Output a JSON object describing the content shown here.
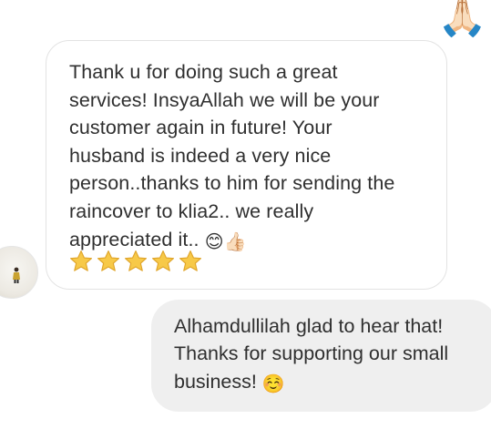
{
  "conversation": {
    "reaction_emoji": "🙏🏻",
    "incoming": {
      "lines": [
        "Thank u for doing such a great",
        "services! InsyaAllah we will be your",
        "customer again in future! Your",
        "husband is indeed a very nice",
        "person..thanks to him for sending the",
        "raincover to klia2.. we really",
        "appreciated it.."
      ],
      "emoji_smile": "😊",
      "emoji_thumbs": "👍🏻",
      "stars": 5,
      "star_color": "#f7c948"
    },
    "outgoing": {
      "lines": [
        "Alhamdullilah glad to hear that!",
        "Thanks for supporting our small",
        "business!"
      ],
      "emoji": "☺️"
    }
  }
}
